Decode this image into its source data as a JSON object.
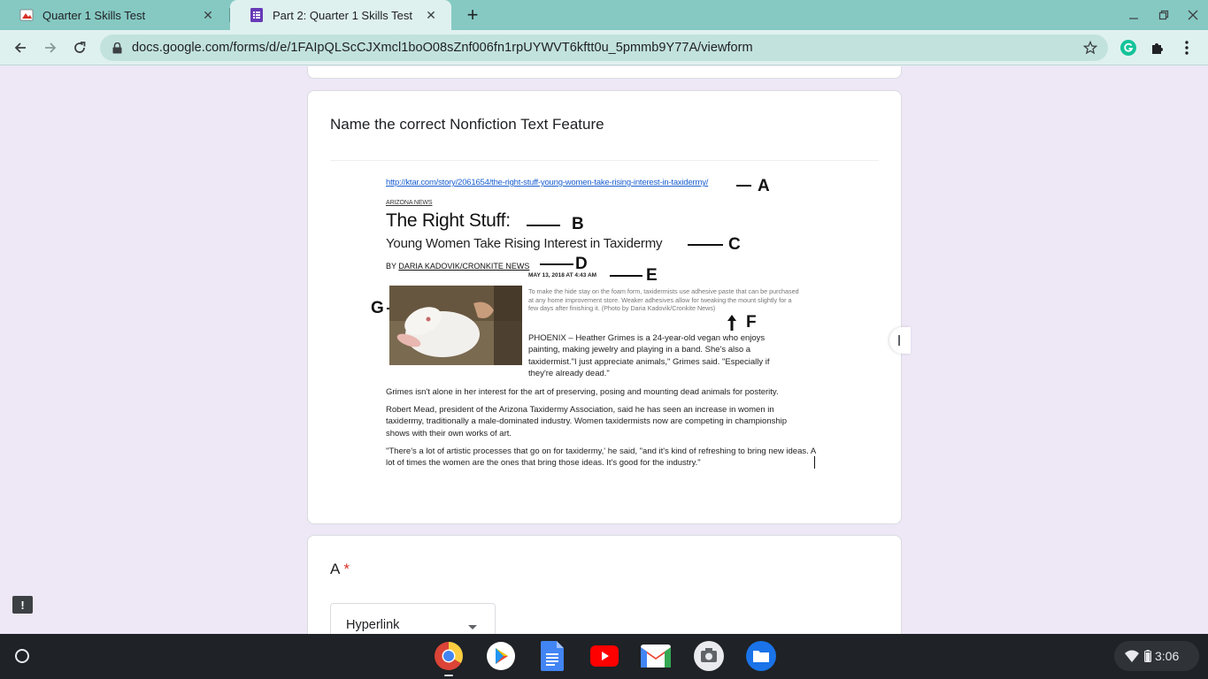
{
  "browser": {
    "tabs": [
      {
        "title": "Quarter 1 Skills Test",
        "icon": "google-drive-slides-icon",
        "active": false
      },
      {
        "title": "Part 2: Quarter 1 Skills Test",
        "icon": "google-forms-icon",
        "active": true
      }
    ],
    "url": "docs.google.com/forms/d/e/1FAIpQLScCJXmcl1boO08sZnf006fn1rpUYWVT6kftt0u_5pmmb9Y77A/viewform"
  },
  "form": {
    "question_title": "Name the correct Nonfiction Text Feature",
    "answer_label": "A",
    "required_marker": "*",
    "selected_answer": "Hyperlink"
  },
  "article": {
    "url": "http://ktar.com/story/2061654/the-right-stuff-young-women-take-rising-interest-in-taxidermy/",
    "section": "ARIZONA NEWS",
    "headline": "The Right Stuff:",
    "subhead": "Young Women Take Rising Interest in Taxidermy",
    "byline_prefix": "BY",
    "byline_name": "DARIA KADOVIK/CRONKITE NEWS",
    "dateline": "MAY 13, 2018 AT 4:43 AM",
    "caption": "To make the hide stay on the foam form, taxidermists use adhesive paste that can be purchased at any home improvement store. Weaker adhesives allow for tweaking the mount slightly for a few days after finishing it. (Photo by Daria Kadovik/Cronkite News)",
    "lead": "PHOENIX – Heather Grimes is a 24-year-old vegan who enjoys painting, making jewelry and playing in a band. She's also a taxidermist.\"I just appreciate animals,\" Grimes said. \"Especially if they're already dead.\"",
    "para1": "Grimes isn't alone in her interest for the art of preserving, posing and mounting dead animals for posterity.",
    "para2": "Robert Mead, president of the Arizona Taxidermy Association, said he has seen an increase in women in taxidermy, traditionally a male-dominated industry. Women taxidermists now are competing in championship shows with their own works of art.",
    "para3": "\"There's a lot of artistic processes that go on for taxidermy,' he said, \"and it's kind of refreshing to bring new ideas. A lot of times the women are the ones that bring those ideas. It's good for the industry.\"",
    "labels": {
      "a": "A",
      "b": "B",
      "c": "C",
      "d": "D",
      "e": "E",
      "f": "F",
      "g": "G"
    }
  },
  "shelf": {
    "apps": [
      "chrome-icon",
      "play-store-icon",
      "google-docs-icon",
      "youtube-icon",
      "gmail-icon",
      "camera-icon",
      "files-icon"
    ],
    "time": "3:06"
  },
  "colors": {
    "tab_strip": "#86c9c3",
    "toolbar": "#dff1ef",
    "page_bg": "#ede7f6",
    "required": "#d93025",
    "link": "#1a5fd0"
  }
}
